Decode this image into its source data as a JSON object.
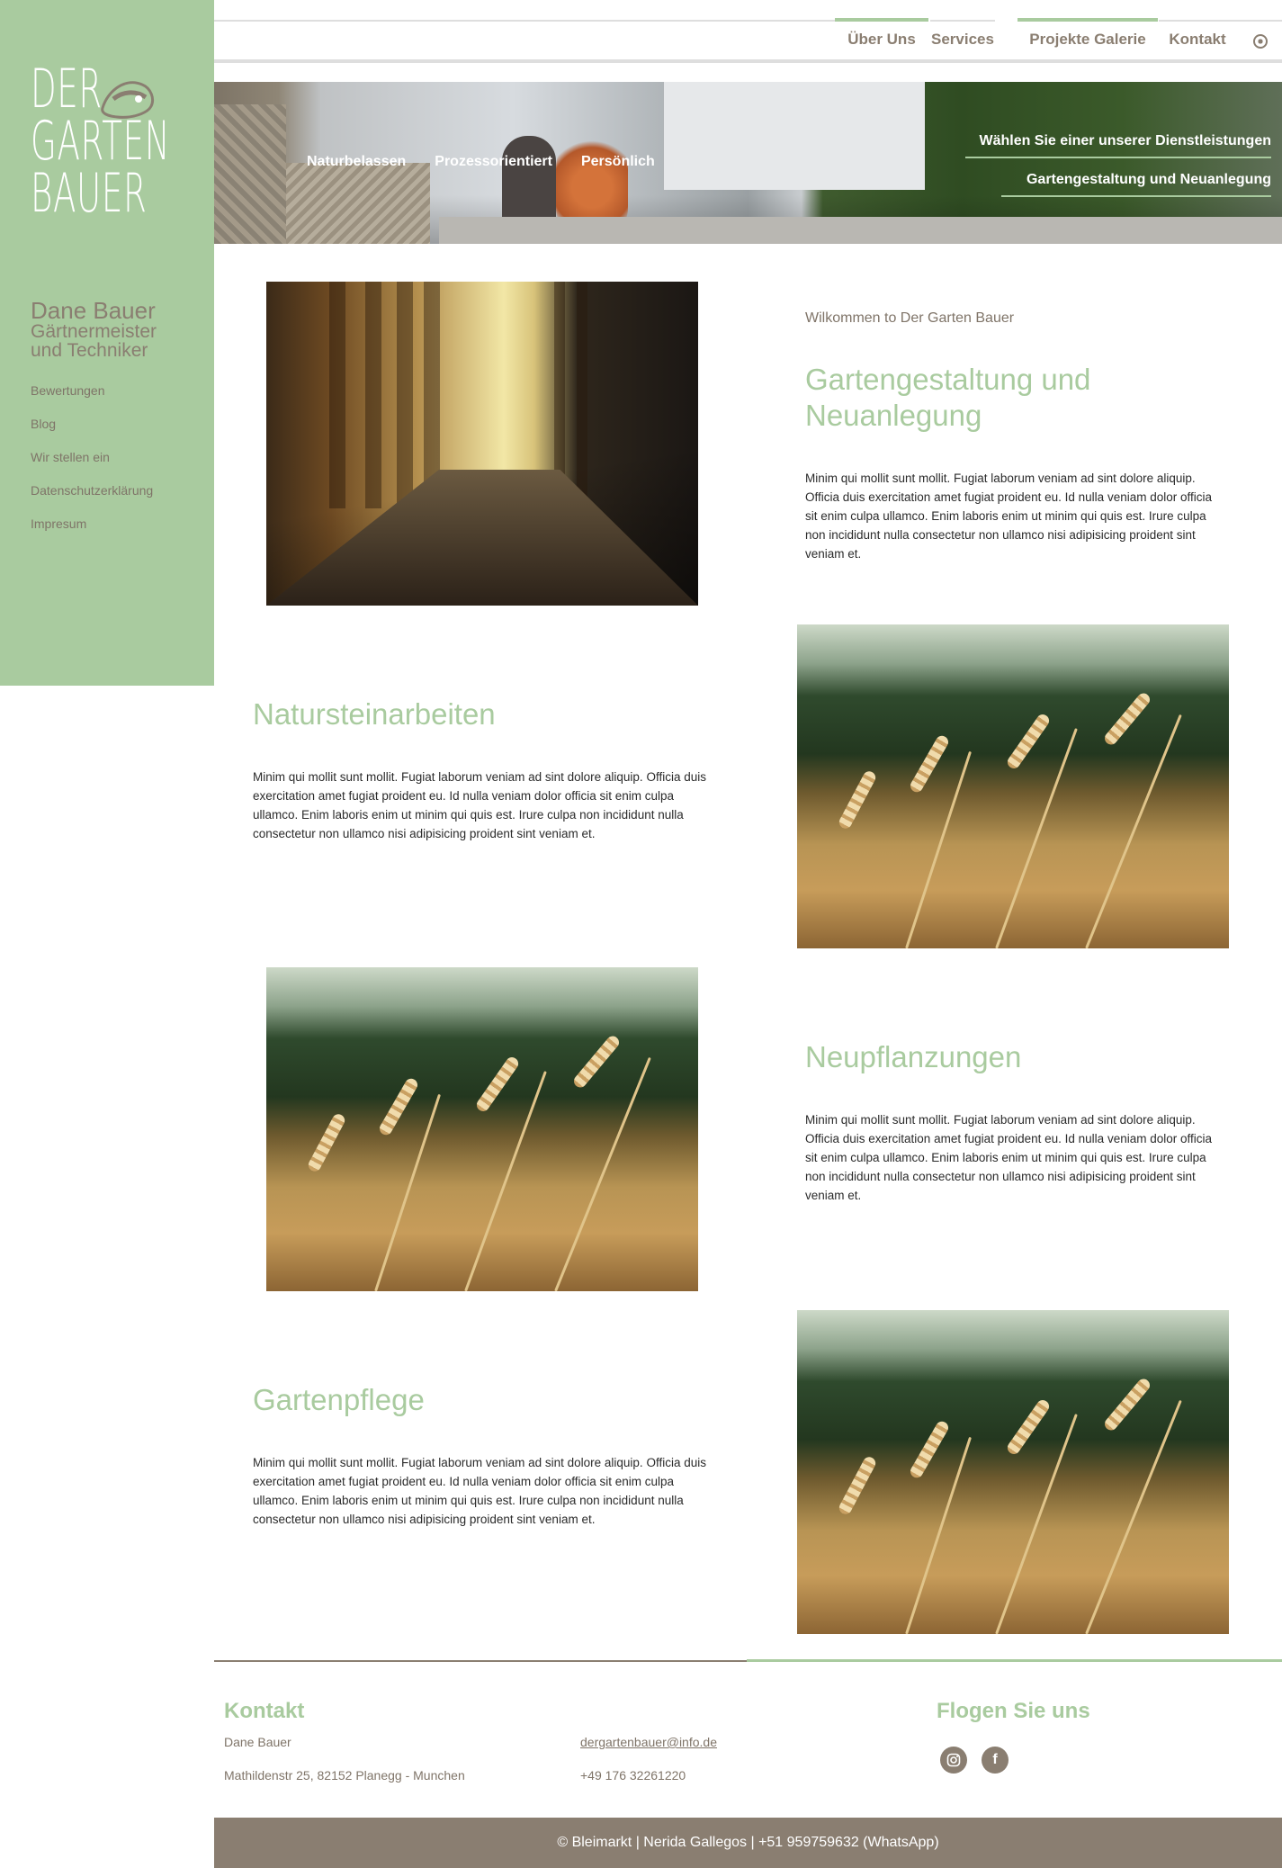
{
  "sidebar": {
    "logo": {
      "line1": "DER",
      "line2": "GARTEN",
      "line3": "BAUER"
    },
    "owner_name": "Dane Bauer",
    "owner_title1": "Gärtnermeister",
    "owner_title2": "und Techniker",
    "links": [
      "Bewertungen",
      "Blog",
      "Wir stellen ein",
      "Datenschutzerklärung",
      "Impresum"
    ]
  },
  "topnav": {
    "items": [
      {
        "label": "Über Uns",
        "active": true
      },
      {
        "label": "Services",
        "active": false
      },
      {
        "label": "Projekte Galerie",
        "active": true
      },
      {
        "label": "Kontakt",
        "active": false
      }
    ],
    "icon": "globe-icon"
  },
  "hero": {
    "links": [
      "Naturbelassen",
      "Prozessorientiert",
      "Persönlich"
    ],
    "cta1": "Wählen Sie einer unserer Dienstleistungen",
    "cta2": "Gartengestaltung und Neuanlegung"
  },
  "sections": {
    "welcome": "Wilkommen to Der Garten Bauer",
    "s1": {
      "title": "Gartengestaltung und Neuanlegung",
      "text": "Minim qui mollit sunt mollit. Fugiat laborum veniam ad sint dolore aliquip. Officia duis exercitation amet fugiat proident eu. Id nulla veniam dolor officia sit enim culpa ullamco. Enim laboris enim ut minim qui quis est. Irure culpa non incididunt nulla consectetur non ullamco nisi adipisicing proident sint veniam et."
    },
    "s2": {
      "title": "Natursteinarbeiten",
      "text": "Minim qui mollit sunt mollit. Fugiat laborum veniam ad sint dolore aliquip. Officia duis exercitation amet fugiat proident eu. Id nulla veniam dolor officia sit enim culpa ullamco. Enim laboris enim ut minim qui quis est. Irure culpa non incididunt nulla consectetur non ullamco nisi adipisicing proident sint veniam et."
    },
    "s3": {
      "title": "Neupflanzungen",
      "text": "Minim qui mollit sunt mollit. Fugiat laborum veniam ad sint dolore aliquip. Officia duis exercitation amet fugiat proident eu. Id nulla veniam dolor officia sit enim culpa ullamco. Enim laboris enim ut minim qui quis est. Irure culpa non incididunt nulla consectetur non ullamco nisi adipisicing proident sint veniam et."
    },
    "s4": {
      "title": "Gartenpflege",
      "text": "Minim qui mollit sunt mollit. Fugiat laborum veniam ad sint dolore aliquip. Officia duis exercitation amet fugiat proident eu. Id nulla veniam dolor officia sit enim culpa ullamco. Enim laboris enim ut minim qui quis est. Irure culpa non incididunt nulla consectetur non ullamco nisi adipisicing proident sint veniam et."
    }
  },
  "footer": {
    "contact_title": "Kontakt",
    "name": "Dane Bauer",
    "address": "Mathildenstr 25, 82152 Planegg - Munchen",
    "email": "dergartenbauer@info.de",
    "phone": "+49 176 32261220",
    "follow_title": "Flogen Sie uns",
    "social": [
      "instagram-icon",
      "facebook-icon"
    ],
    "copyright": "© Bleimarkt | Nerida Gallegos | +51 959759632 (WhatsApp)"
  },
  "colors": {
    "accent": "#a9cb9f",
    "brown": "#8a7e71"
  }
}
